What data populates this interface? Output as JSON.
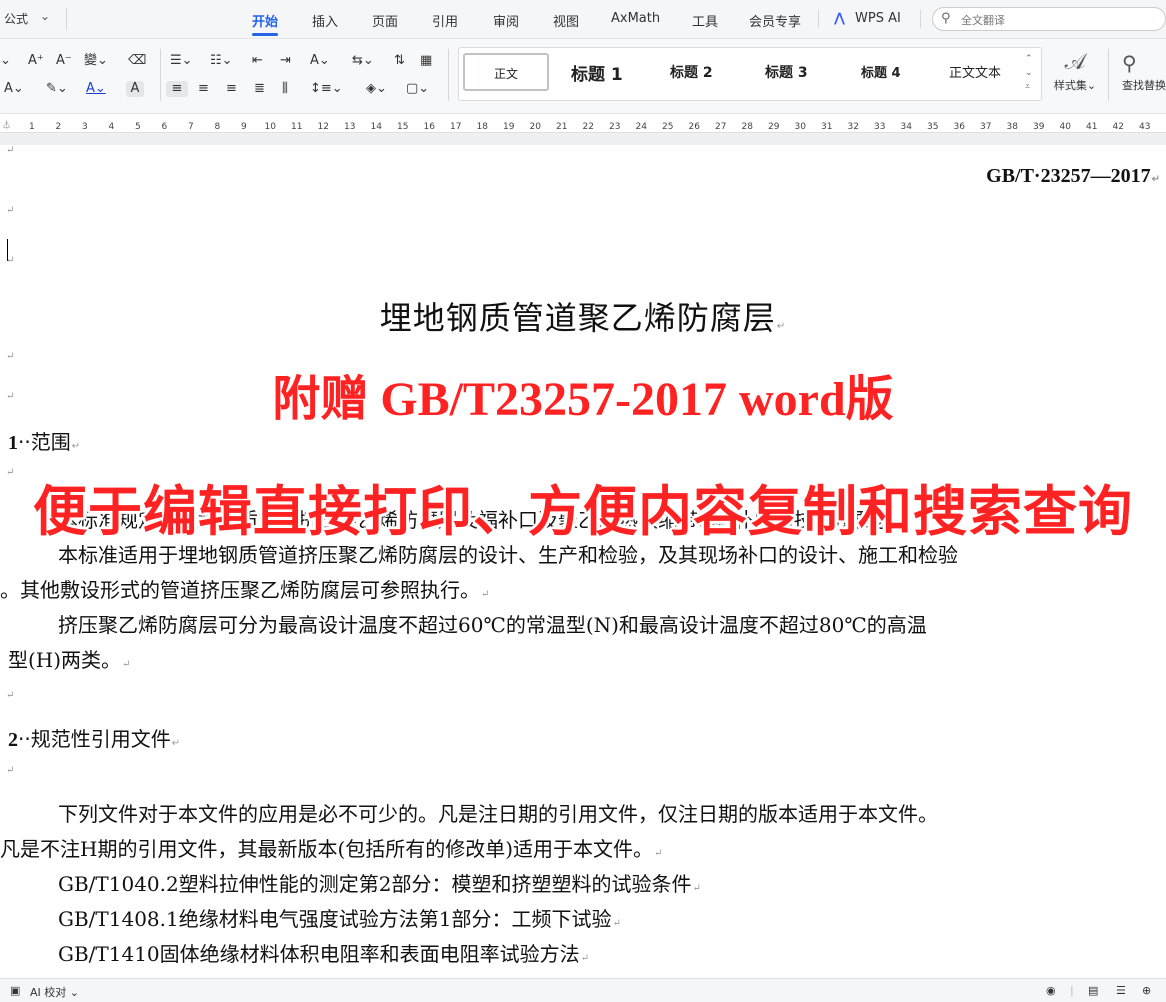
{
  "menubar": {
    "format_label": "公式",
    "tabs": [
      {
        "label": "开始",
        "active": true
      },
      {
        "label": "插入"
      },
      {
        "label": "页面"
      },
      {
        "label": "引用"
      },
      {
        "label": "审阅"
      },
      {
        "label": "视图"
      },
      {
        "label": "AxMath"
      },
      {
        "label": "工具"
      },
      {
        "label": "会员专享"
      },
      {
        "label": "WPS AI"
      }
    ],
    "search_placeholder": "全文翻译"
  },
  "toolbar": {
    "styles": [
      "正文",
      "标题 1",
      "标题 2",
      "标题 3",
      "标题 4",
      "正文文本"
    ],
    "style_set_label": "样式集",
    "find_replace_label": "查找替换"
  },
  "ruler": {
    "marks": [
      "1",
      "2",
      "3",
      "4",
      "5",
      "6",
      "7",
      "8",
      "9",
      "10",
      "11",
      "12",
      "13",
      "14",
      "15",
      "16",
      "17",
      "18",
      "19",
      "20",
      "21",
      "22",
      "23",
      "24",
      "25",
      "26",
      "27",
      "28",
      "29",
      "30",
      "31",
      "32",
      "33",
      "34",
      "35",
      "36",
      "37",
      "38",
      "39",
      "40",
      "41",
      "42",
      "43"
    ]
  },
  "document": {
    "standard_number": "GB/T·23257—2017",
    "title": "埋地钢质管道聚乙烯防腐层",
    "section1_number": "1",
    "section1_title": "范围",
    "section1_para1": "本标准规定了埋地钢质管道挤压聚乙烯防腐层及福补口及聚乙烯热收缩带(套)补口的技术及要求。",
    "section1_para2_l1": "本标准适用于埋地钢质管道挤压聚乙烯防腐层的设计、生产和检验，及其现场补口的设计、施工和检验",
    "section1_para2_l2": "。其他敷设形式的管道挤压聚乙烯防腐层可参照执行。",
    "section1_para3_l1": "挤压聚乙烯防腐层可分为最高设计温度不超过60℃的常温型(N)和最高设计温度不超过80℃的高温",
    "section1_para3_l2": "型(H)两类。",
    "section2_number": "2",
    "section2_title": "规范性引用文件",
    "section2_para1_l1": "下列文件对于本文件的应用是必不可少的。凡是注日期的引用文件，仅注日期的版本适用于本文件。",
    "section2_para1_l2": "凡是不注H期的引用文件，其最新版本(包括所有的修改单)适用于本文件。",
    "ref1": "GB/T1040.2塑料拉伸性能的测定第2部分：模塑和挤塑塑料的试验条件",
    "ref2": "GB/T1408.1绝缘材料电气强度试验方法第1部分：工频下试验",
    "ref3": "GB/T1410固体绝缘材料体积电阻率和表面电阻率试验方法"
  },
  "overlay": {
    "line1": "附赠 GB/T23257-2017 word版",
    "line2": "便于编辑直接打印、方便内容复制和搜索查询",
    "color": "#ff2222"
  },
  "statusbar": {
    "ai_check": "AI 校对"
  }
}
